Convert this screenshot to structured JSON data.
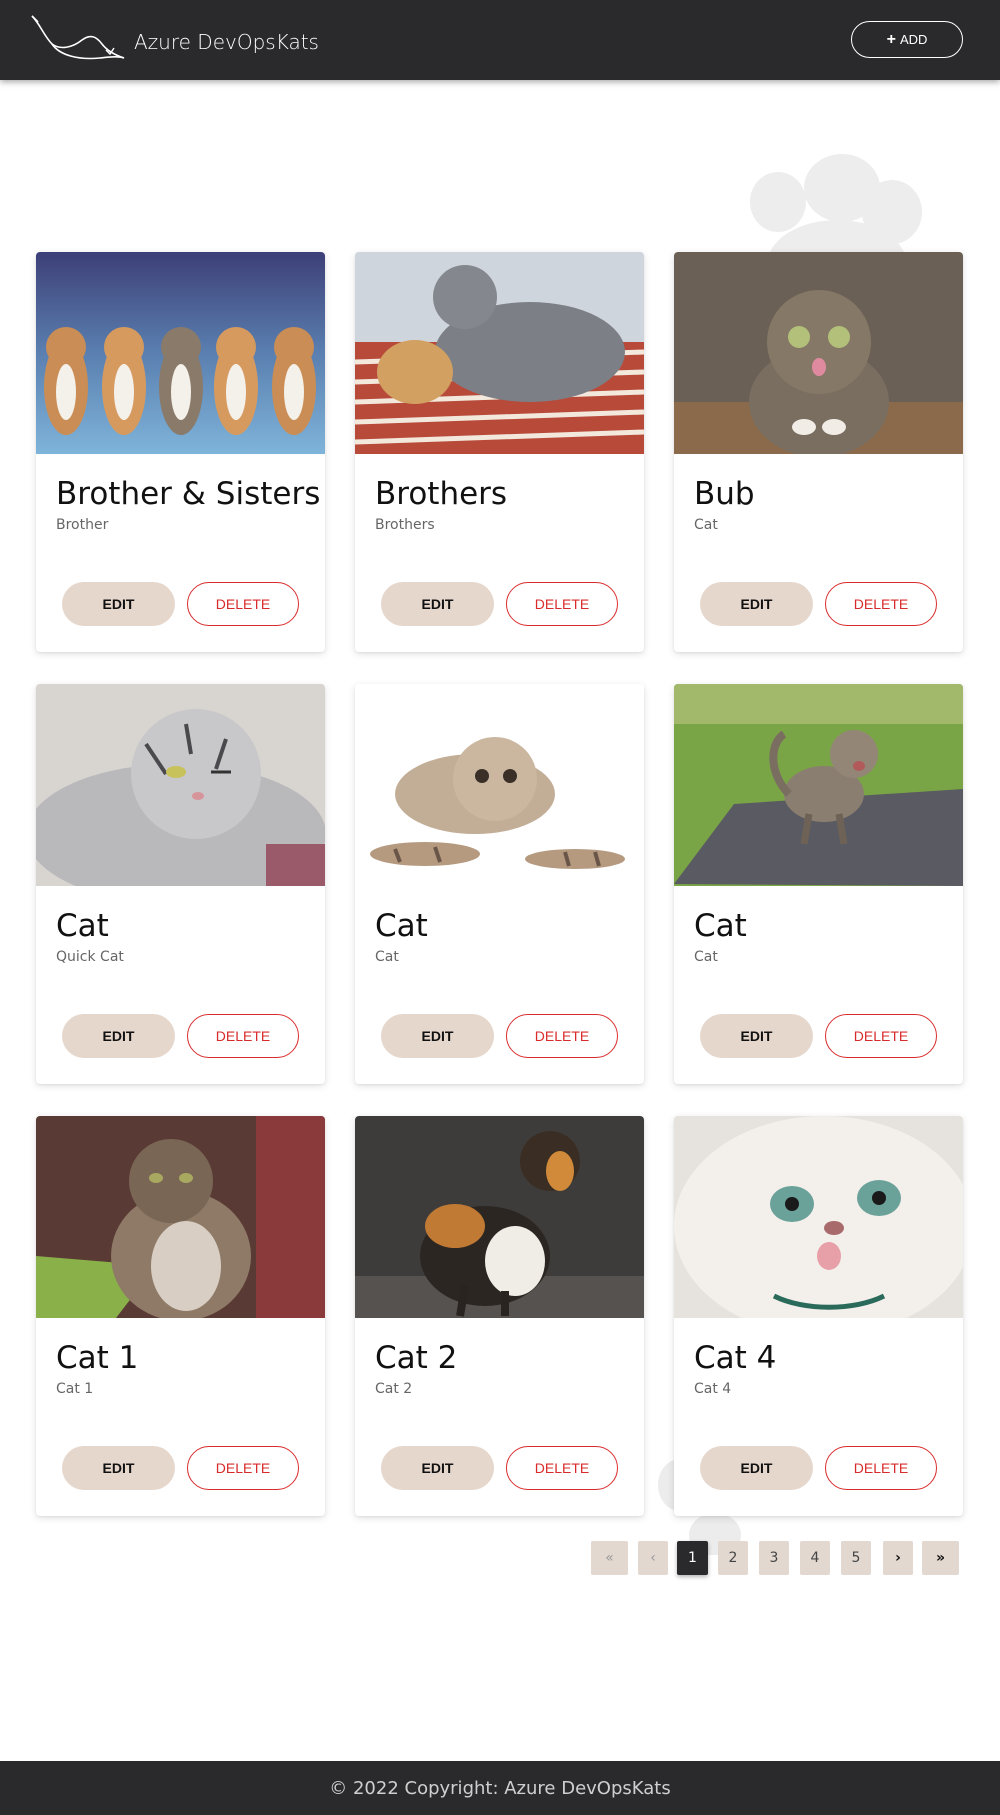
{
  "header": {
    "brand_name": "Azure DevOpsKats",
    "add_label": "ADD",
    "add_icon": "plus-icon"
  },
  "cards": [
    {
      "title": "Brother & Sisters",
      "subtitle": "Brother",
      "edit_label": "EDIT",
      "delete_label": "DELETE",
      "image": "kittens-row-photo"
    },
    {
      "title": "Brothers",
      "subtitle": "Brothers",
      "edit_label": "EDIT",
      "delete_label": "DELETE",
      "image": "grey-and-ginger-cats-photo"
    },
    {
      "title": "Bub",
      "subtitle": "Cat",
      "edit_label": "EDIT",
      "delete_label": "DELETE",
      "image": "tabby-cat-tongue-photo"
    },
    {
      "title": "Cat",
      "subtitle": "Quick Cat",
      "edit_label": "EDIT",
      "delete_label": "DELETE",
      "image": "silver-tabby-wink-photo"
    },
    {
      "title": "Cat",
      "subtitle": "Cat",
      "edit_label": "EDIT",
      "delete_label": "DELETE",
      "image": "kitten-stretch-photo"
    },
    {
      "title": "Cat",
      "subtitle": "Cat",
      "edit_label": "EDIT",
      "delete_label": "DELETE",
      "image": "kitten-on-grass-photo"
    },
    {
      "title": "Cat 1",
      "subtitle": "Cat 1",
      "edit_label": "EDIT",
      "delete_label": "DELETE",
      "image": "longhair-tabby-photo"
    },
    {
      "title": "Cat 2",
      "subtitle": "Cat 2",
      "edit_label": "EDIT",
      "delete_label": "DELETE",
      "image": "calico-kitten-photo"
    },
    {
      "title": "Cat 4",
      "subtitle": "Cat 4",
      "edit_label": "EDIT",
      "delete_label": "DELETE",
      "image": "persian-cat-photo"
    }
  ],
  "pagination": {
    "first_icon": "double-chevron-left-icon",
    "prev_icon": "chevron-left-icon",
    "pages": [
      "1",
      "2",
      "3",
      "4",
      "5"
    ],
    "current_page": "1",
    "next_icon": "chevron-right-icon",
    "last_icon": "double-chevron-right-icon"
  },
  "footer": {
    "text": "© 2022 Copyright: Azure DevOpsKats"
  },
  "colors": {
    "nav_bg": "#2a2a2c",
    "edit_bg": "#e6d7cd",
    "delete_accent": "#d92b2b",
    "page_bg": "#e3d8d0"
  }
}
